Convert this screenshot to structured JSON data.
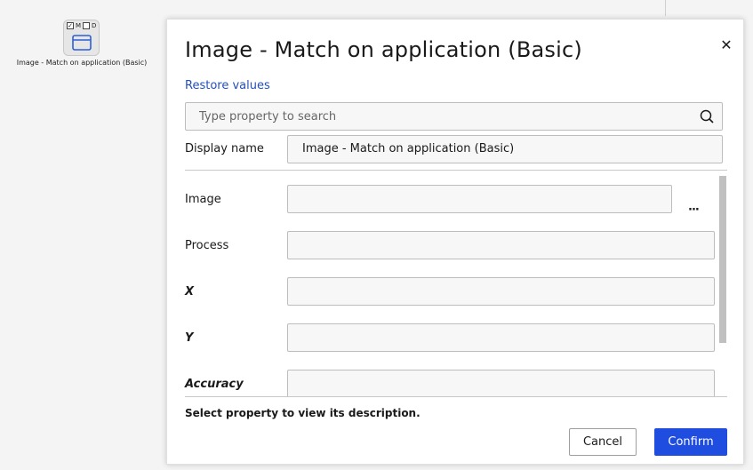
{
  "canvas": {
    "node_flags": {
      "m_label": "M",
      "d_label": "D"
    },
    "node_caption": "Image - Match on application (Basic)"
  },
  "dialog": {
    "title": "Image - Match on application (Basic)",
    "restore_label": "Restore values",
    "search": {
      "placeholder": "Type property to search",
      "value": ""
    },
    "display_name": {
      "label": "Display name",
      "value": "Image - Match on application (Basic)"
    },
    "properties": [
      {
        "label": "Image",
        "value": ""
      },
      {
        "label": "Process",
        "value": ""
      },
      {
        "label": "X",
        "value": ""
      },
      {
        "label": "Y",
        "value": ""
      },
      {
        "label": "Accuracy",
        "value": ""
      }
    ],
    "image_browse_label": "···",
    "description": "Select property to view its description.",
    "cancel_label": "Cancel",
    "confirm_label": "Confirm"
  },
  "colors": {
    "accent": "#1f4de0",
    "link": "#2450b8",
    "field_bg": "#f7f7f7"
  }
}
